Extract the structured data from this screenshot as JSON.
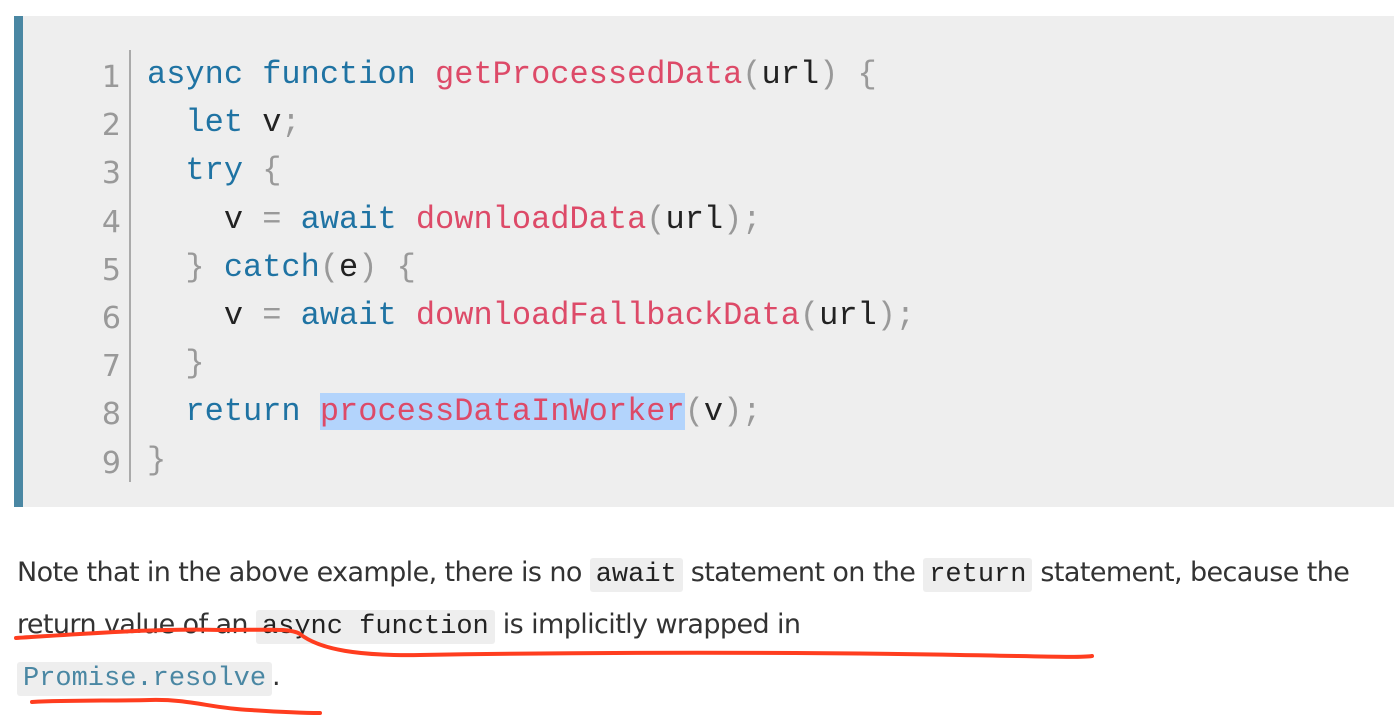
{
  "code": {
    "line_numbers": [
      "1",
      "2",
      "3",
      "4",
      "5",
      "6",
      "7",
      "8",
      "9"
    ],
    "selected_text": "processDataInWorker",
    "lines": [
      [
        [
          "kw",
          "async "
        ],
        [
          "kw",
          "function "
        ],
        [
          "fn",
          "getProcessedData"
        ],
        [
          "p",
          "("
        ],
        [
          "v",
          "url"
        ],
        [
          "p",
          ") {"
        ]
      ],
      [
        [
          "v",
          "  "
        ],
        [
          "kw",
          "let "
        ],
        [
          "v",
          "v"
        ],
        [
          "p",
          ";"
        ]
      ],
      [
        [
          "v",
          "  "
        ],
        [
          "kw",
          "try "
        ],
        [
          "p",
          "{"
        ]
      ],
      [
        [
          "v",
          "    v "
        ],
        [
          "p",
          "= "
        ],
        [
          "kw",
          "await "
        ],
        [
          "fn",
          "downloadData"
        ],
        [
          "p",
          "("
        ],
        [
          "v",
          "url"
        ],
        [
          "p",
          ");"
        ]
      ],
      [
        [
          "v",
          "  "
        ],
        [
          "p",
          "} "
        ],
        [
          "kw",
          "catch"
        ],
        [
          "p",
          "("
        ],
        [
          "v",
          "e"
        ],
        [
          "p",
          ") {"
        ]
      ],
      [
        [
          "v",
          "    v "
        ],
        [
          "p",
          "= "
        ],
        [
          "kw",
          "await "
        ],
        [
          "fn",
          "downloadFallbackData"
        ],
        [
          "p",
          "("
        ],
        [
          "v",
          "url"
        ],
        [
          "p",
          ");"
        ]
      ],
      [
        [
          "v",
          "  "
        ],
        [
          "p",
          "}"
        ]
      ],
      [
        [
          "v",
          "  "
        ],
        [
          "kw",
          "return "
        ],
        [
          "sel",
          "processDataInWorker"
        ],
        [
          "p",
          "("
        ],
        [
          "v",
          "v"
        ],
        [
          "p",
          ");"
        ]
      ],
      [
        [
          "p",
          "}"
        ]
      ]
    ]
  },
  "paragraph": {
    "t1": "Note that in the above example, there is no ",
    "c1": "await",
    "t2": " statement on the ",
    "c2": "return",
    "t3": " statement, because the return value of an ",
    "c3": "async function",
    "t4": " is implicitly wrapped in ",
    "c4": "Promise.resolve",
    "t5": "."
  },
  "colors": {
    "accent": "#4a87a3",
    "keyword": "#1f73a3",
    "function": "#dd4a68",
    "annotation": "#ff3d1f",
    "selection": "#b3d4fc"
  }
}
